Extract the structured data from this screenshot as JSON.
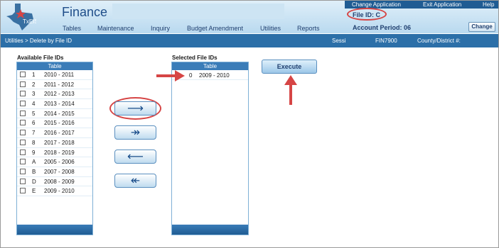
{
  "header": {
    "app_title": "Finance",
    "logo_text": "TxEIS",
    "nav": [
      "Tables",
      "Maintenance",
      "Inquiry",
      "Budget Amendment",
      "Utilities",
      "Reports"
    ],
    "top_links": [
      "Change Application",
      "Exit Application",
      "Help"
    ],
    "file_id": "File ID: C",
    "account_period": "Account Period: 06",
    "change_label": "Change"
  },
  "breadcrumb": {
    "path": "Utilities > Delete by File ID",
    "session": "Sessi",
    "fin_code": "FIN7900",
    "county_district": "County/District #:"
  },
  "available": {
    "title": "Available File IDs",
    "column": "Table",
    "rows": [
      {
        "code": "1",
        "years": "2010 - 2011"
      },
      {
        "code": "2",
        "years": "2011 - 2012"
      },
      {
        "code": "3",
        "years": "2012 - 2013"
      },
      {
        "code": "4",
        "years": "2013 - 2014"
      },
      {
        "code": "5",
        "years": "2014 - 2015"
      },
      {
        "code": "6",
        "years": "2015 - 2016"
      },
      {
        "code": "7",
        "years": "2016 - 2017"
      },
      {
        "code": "8",
        "years": "2017 - 2018"
      },
      {
        "code": "9",
        "years": "2018 - 2019"
      },
      {
        "code": "A",
        "years": "2005 - 2006"
      },
      {
        "code": "B",
        "years": "2007 - 2008"
      },
      {
        "code": "D",
        "years": "2008 - 2009"
      },
      {
        "code": "E",
        "years": "2009 - 2010"
      }
    ]
  },
  "selected": {
    "title": "Selected File IDs",
    "column": "Table",
    "rows": [
      {
        "code": "0",
        "years": "2009 - 2010"
      }
    ]
  },
  "buttons": {
    "move_one": "⟶",
    "move_all": "↠",
    "remove_one": "⟵",
    "remove_all": "↞",
    "execute": "Execute"
  },
  "colors": {
    "accent": "#2c6fa8",
    "highlight": "#d64545"
  }
}
